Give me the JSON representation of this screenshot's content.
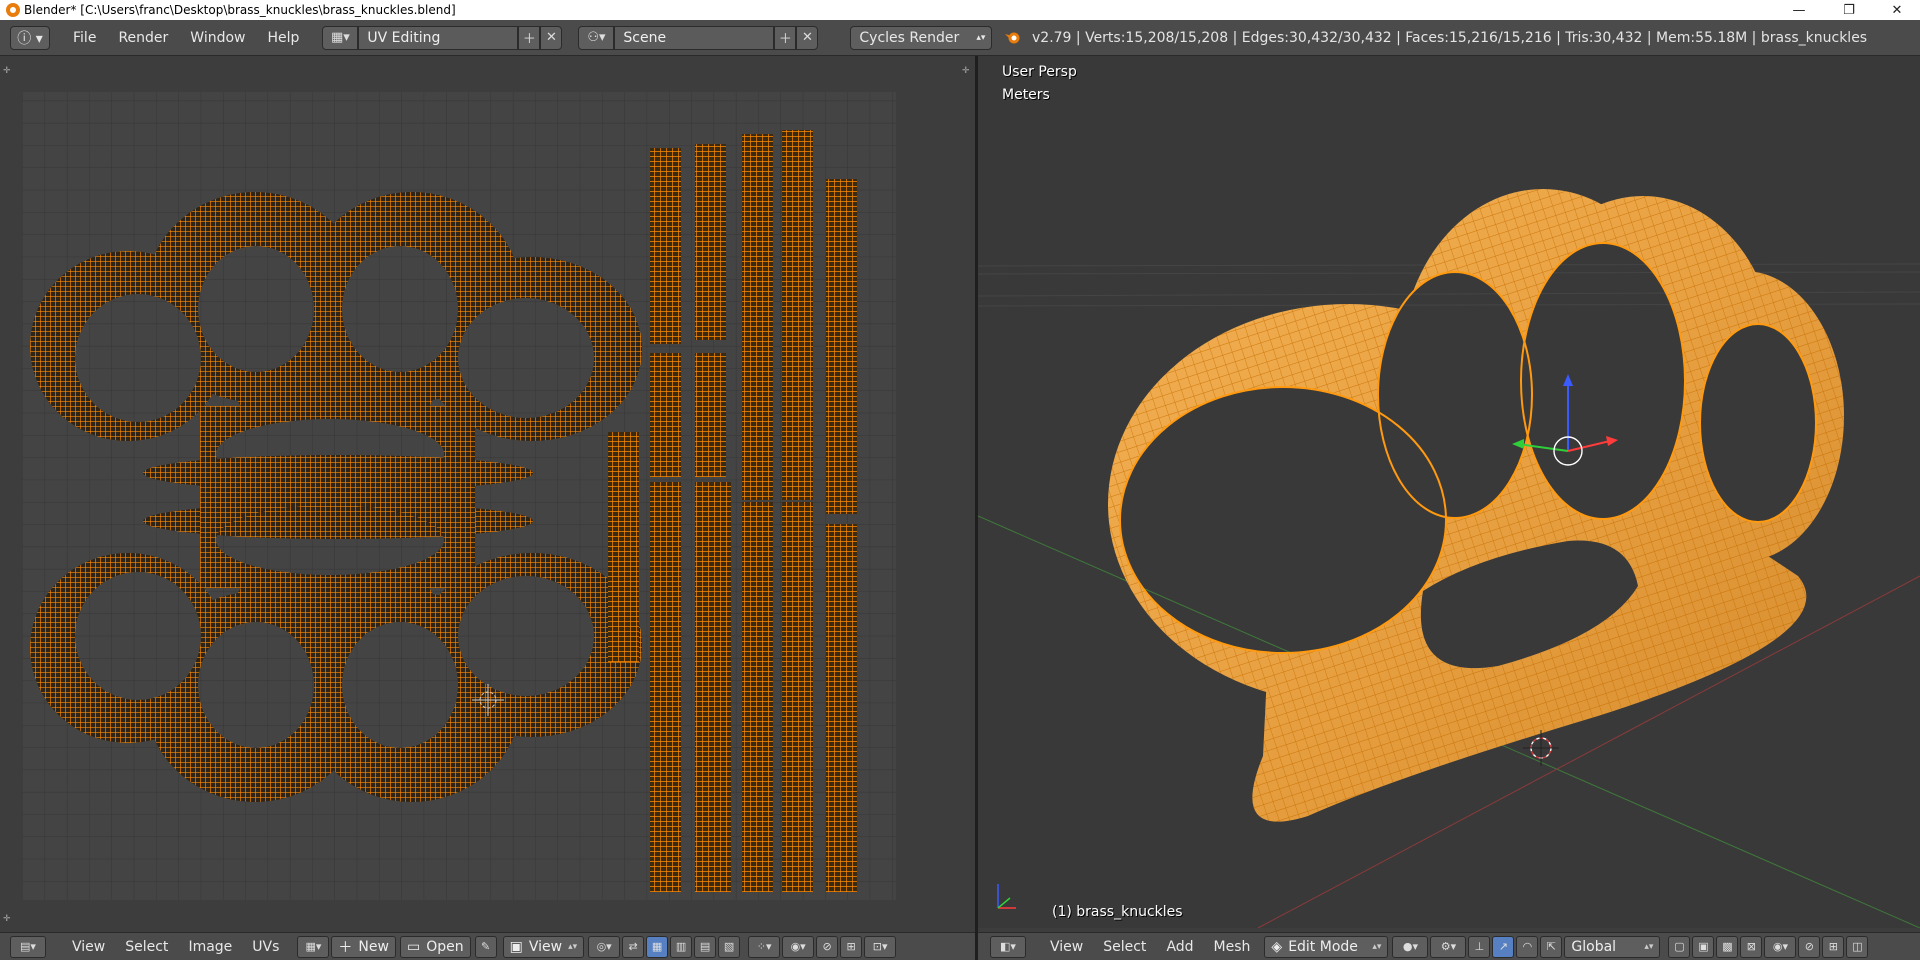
{
  "window": {
    "title": "Blender* [C:\\Users\\franc\\Desktop\\brass_knuckles\\brass_knuckles.blend]",
    "minimize_glyph": "—",
    "restore_glyph": "❐",
    "close_glyph": "✕"
  },
  "topbar": {
    "menus": [
      "File",
      "Render",
      "Window",
      "Help"
    ],
    "screen_layout": "UV Editing",
    "scene": "Scene",
    "render_engine": "Cycles Render",
    "stats": "v2.79 | Verts:15,208/15,208 | Edges:30,432/30,432 | Faces:15,216/15,216 | Tris:30,432 | Mem:55.18M | brass_knuckles"
  },
  "uv_editor": {
    "menus": [
      "View",
      "Select",
      "Image",
      "UVs"
    ],
    "new_label": "New",
    "open_label": "Open",
    "view_label": "View"
  },
  "viewport": {
    "view_name": "User Persp",
    "units": "Meters",
    "object_label": "(1) brass_knuckles",
    "menus": [
      "View",
      "Select",
      "Add",
      "Mesh"
    ],
    "mode": "Edit Mode",
    "orientation": "Global"
  },
  "colors": {
    "uv_wire": "#ff8a00",
    "mesh_fill": "#f0a746",
    "mesh_wire": "#ffa218",
    "selection_active": "#5680c2",
    "grid_bg": "#444444"
  }
}
